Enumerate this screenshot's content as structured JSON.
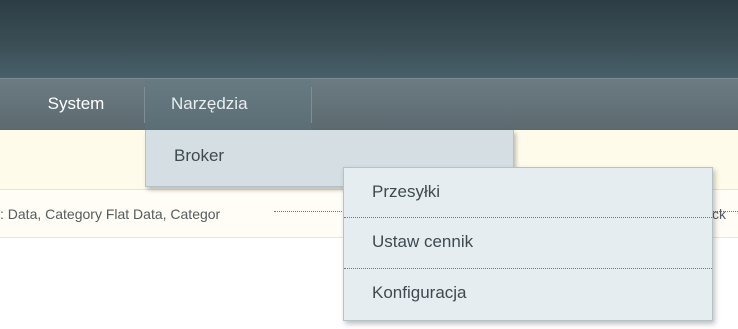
{
  "nav": {
    "items": [
      {
        "label": "System"
      },
      {
        "label": "Narzędzia"
      }
    ]
  },
  "dropdown": {
    "label": "Broker",
    "submenu": [
      {
        "label": "Przesyłki"
      },
      {
        "label": "Ustaw cennik"
      },
      {
        "label": "Konfiguracja"
      }
    ]
  },
  "notice": {
    "text": ": Data, Category Flat Data, Categor",
    "suffix": "ck"
  }
}
